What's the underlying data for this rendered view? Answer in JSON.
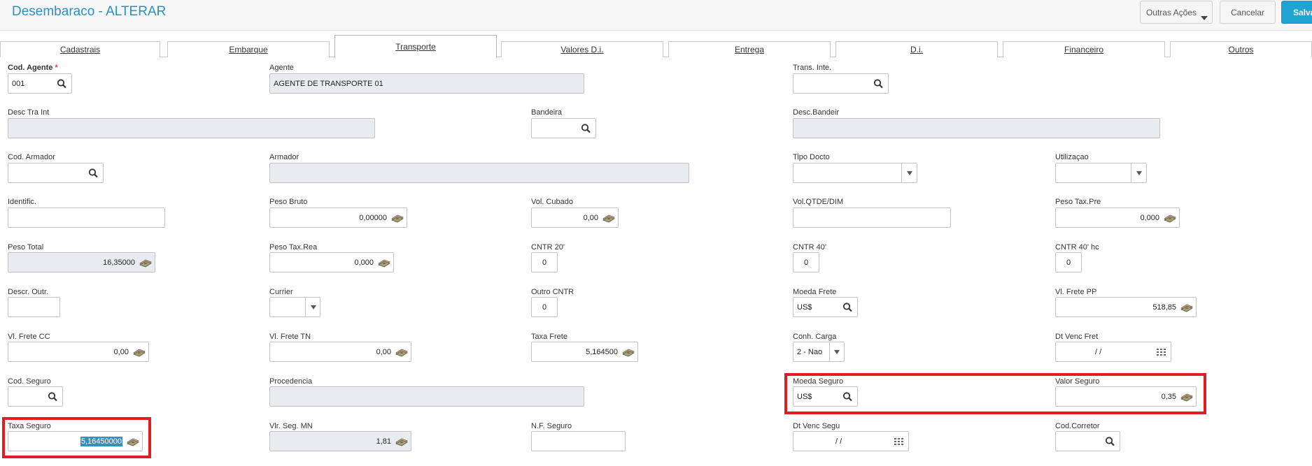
{
  "header": {
    "title": "Desembaraco - ALTERAR",
    "buttons": {
      "outras_acoes": "Outras Ações",
      "cancelar": "Cancelar",
      "salvar": "Salva"
    }
  },
  "tabs": [
    "Cadastrais",
    "Embarque",
    "Transporte",
    "Valores D.i.",
    "Entrega",
    "D.i.",
    "Financeiro",
    "Outros"
  ],
  "active_tab": "Transporte",
  "form": {
    "cod_agente": {
      "label": "Cod. Agente",
      "required_mark": "*",
      "value": "001"
    },
    "agente": {
      "label": "Agente",
      "value": "AGENTE DE TRANSPORTE 01"
    },
    "trans_inte": {
      "label": "Trans. Inte.",
      "value": ""
    },
    "desc_tra_int": {
      "label": "Desc Tra Int",
      "value": ""
    },
    "bandeira": {
      "label": "Bandeira",
      "value": ""
    },
    "desc_bandeir": {
      "label": "Desc.Bandeir",
      "value": ""
    },
    "cod_armador": {
      "label": "Cod. Armador",
      "value": ""
    },
    "armador": {
      "label": "Armador",
      "value": ""
    },
    "tipo_docto": {
      "label": "Tipo Docto",
      "value": ""
    },
    "utilizacao": {
      "label": "Utilizaçao",
      "value": ""
    },
    "identific": {
      "label": "Identific.",
      "value": ""
    },
    "peso_bruto": {
      "label": "Peso Bruto",
      "value": "0,00000"
    },
    "vol_cubado": {
      "label": "Vol. Cubado",
      "value": "0,00"
    },
    "vol_qtde_dim": {
      "label": "Vol.QTDE/DIM",
      "value": ""
    },
    "peso_tax_pre": {
      "label": "Peso Tax.Pre",
      "value": "0,000"
    },
    "peso_total": {
      "label": "Peso Total",
      "value": "16,35000"
    },
    "peso_tax_rea": {
      "label": "Peso Tax.Rea",
      "value": "0,000"
    },
    "cntr_20": {
      "label": "CNTR 20'",
      "value": "0"
    },
    "cntr_40": {
      "label": "CNTR 40'",
      "value": "0"
    },
    "cntr_40_hc": {
      "label": "CNTR 40' hc",
      "value": "0"
    },
    "descr_outr": {
      "label": "Descr. Outr.",
      "value": ""
    },
    "currier": {
      "label": "Currier",
      "value": ""
    },
    "outro_cntr": {
      "label": "Outro CNTR",
      "value": "0"
    },
    "moeda_frete": {
      "label": "Moeda Frete",
      "value": "US$"
    },
    "vl_frete_pp": {
      "label": "Vl. Frete PP",
      "value": "518,85"
    },
    "vl_frete_cc": {
      "label": "Vl. Frete CC",
      "value": "0,00"
    },
    "vl_frete_tn": {
      "label": "Vl. Frete TN",
      "value": "0,00"
    },
    "taxa_frete": {
      "label": "Taxa Frete",
      "value": "5,164500"
    },
    "conh_carga": {
      "label": "Conh. Carga",
      "value": "2 - Nao"
    },
    "dt_venc_fret": {
      "label": "Dt Venc Fret",
      "value": "/ /"
    },
    "cod_seguro": {
      "label": "Cod. Seguro",
      "value": ""
    },
    "procedencia": {
      "label": "Procedencia",
      "value": ""
    },
    "moeda_seguro": {
      "label": "Moeda Seguro",
      "value": "US$"
    },
    "valor_seguro": {
      "label": "Valor Seguro",
      "value": "0,35"
    },
    "taxa_seguro": {
      "label": "Taxa Seguro",
      "value": "5,16450000"
    },
    "vlr_seg_mn": {
      "label": "Vlr. Seg. MN",
      "value": "1,81"
    },
    "nf_seguro": {
      "label": "N.F. Seguro",
      "value": ""
    },
    "dt_venc_segu": {
      "label": "Dt Venc Segu",
      "value": "/ /"
    },
    "cod_corretor": {
      "label": "Cod.Corretor",
      "value": ""
    }
  },
  "colors": {
    "title": "#2b8fc0",
    "primary_button": "#1fa3d3",
    "highlight_box": "#e31b23",
    "readonly_field": "#e8ebf0"
  }
}
